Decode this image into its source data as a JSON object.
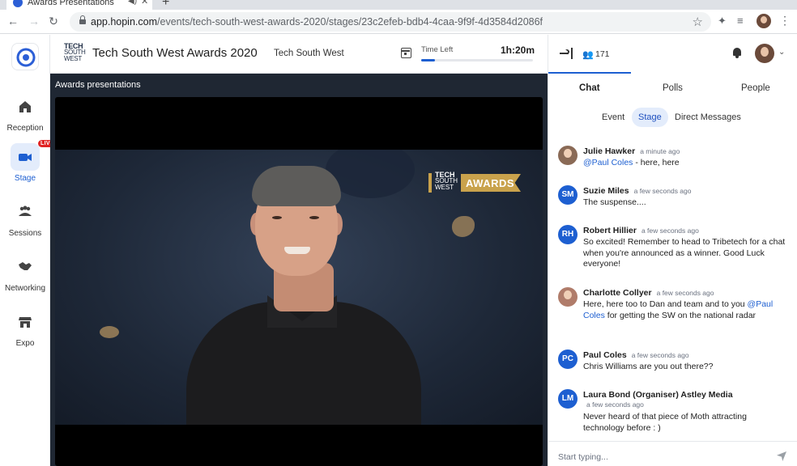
{
  "browser": {
    "tab_title": "Awards Presentations",
    "url_host": "app.hopin.com",
    "url_path": "/events/tech-south-west-awards-2020/stages/23c2efeb-bdb4-4caa-9f9f-4d3584d2086f"
  },
  "sidebar": {
    "items": [
      {
        "label": "Reception",
        "icon": "home-icon"
      },
      {
        "label": "Stage",
        "icon": "video-camera-icon",
        "badge": "LIVE"
      },
      {
        "label": "Sessions",
        "icon": "people-group-icon"
      },
      {
        "label": "Networking",
        "icon": "handshake-icon"
      },
      {
        "label": "Expo",
        "icon": "store-icon"
      }
    ]
  },
  "header": {
    "logo_lines": [
      "TECH",
      "SOUTH",
      "WEST"
    ],
    "title": "Tech South West Awards 2020",
    "organizer": "Tech South West",
    "time_left_label": "Time Left",
    "time_left_value": "1h:20m",
    "time_progress": 0.12
  },
  "stage": {
    "title": "Awards presentations",
    "overlay_badge_lines": [
      "TECH",
      "SOUTH",
      "WEST"
    ],
    "overlay_badge_text": "AWARDS"
  },
  "panel": {
    "attendee_count": "171",
    "tabs": [
      "Chat",
      "Polls",
      "People"
    ],
    "active_tab": "Chat",
    "sub_tabs": [
      "Event",
      "Stage",
      "Direct Messages"
    ],
    "active_sub_tab": "Stage",
    "messages": [
      {
        "name": "Julie Hawker",
        "time": "a minute ago",
        "mention": "@Paul Coles",
        "text": " - here, here",
        "avatar": "photo"
      },
      {
        "name": "Suzie Miles",
        "time": "a few seconds ago",
        "mention": "",
        "text": "The suspense....",
        "initials": "SM"
      },
      {
        "name": "Robert Hillier",
        "time": "a few seconds ago",
        "mention": "",
        "text": "So excited! Remember to head to Tribetech for a chat when you're announced as a winner. Good Luck everyone!",
        "initials": "RH"
      },
      {
        "name": "Charlotte Collyer",
        "time": "a few seconds ago",
        "text_before": "Here, here too to Dan and team and to you ",
        "mention": "@Paul Coles",
        "text": " for getting the SW on the national radar",
        "avatar": "photo"
      },
      {
        "name": "Paul Coles",
        "time": "a few seconds ago",
        "mention": "",
        "text": "Chris Williams are you out there??",
        "initials": "PC"
      },
      {
        "name": "Laura Bond (Organiser) Astley Media",
        "time": "a few seconds ago",
        "mention": "",
        "text": "Never heard of that piece of Moth attracting technology before : )",
        "initials": "LM"
      }
    ],
    "composer_placeholder": "Start typing..."
  },
  "colors": {
    "accent": "#1d5fd1",
    "avatar_blue": "#1d5fd1",
    "live_red": "#e02424",
    "stage_bg": "#1f2733"
  }
}
